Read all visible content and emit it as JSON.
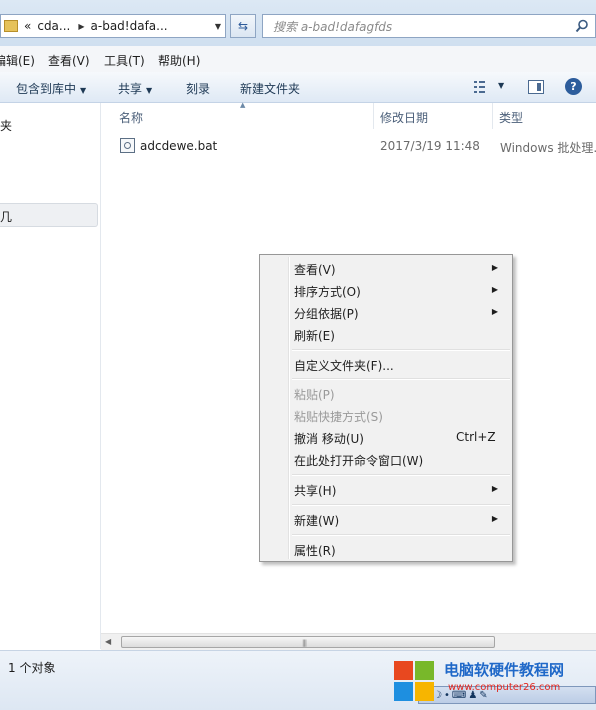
{
  "address_bar": {
    "segments": [
      "«",
      "cda...",
      "a-bad!dafa..."
    ],
    "search_placeholder": "搜索 a-bad!dafagfds"
  },
  "menubar": {
    "items": [
      "编辑(E)",
      "查看(V)",
      "工具(T)",
      "帮助(H)"
    ]
  },
  "toolbar": {
    "include_library": "包含到库中",
    "share": "共享",
    "burn": "刻录",
    "new_folder": "新建文件夹",
    "help_glyph": "?"
  },
  "navpane": {
    "item_partial_1": "夹",
    "item_partial_2": "几"
  },
  "columns": {
    "name": "名称",
    "date": "修改日期",
    "type": "类型"
  },
  "files": [
    {
      "name": "adcdewe.bat",
      "date": "2017/3/19 11:48",
      "type": "Windows 批处理..."
    }
  ],
  "context_menu": {
    "view": "查看(V)",
    "sort": "排序方式(O)",
    "group": "分组依据(P)",
    "refresh": "刷新(E)",
    "customize": "自定义文件夹(F)...",
    "paste": "粘贴(P)",
    "paste_shortcut": "粘贴快捷方式(S)",
    "undo_move": "撤消 移动(U)",
    "undo_shortcut": "Ctrl+Z",
    "open_cmd": "在此处打开命令窗口(W)",
    "share": "共享(H)",
    "new": "新建(W)",
    "properties": "属性(R)"
  },
  "statusbar": {
    "count": "1 个对象"
  },
  "watermark": {
    "title": "电脑软硬件教程网",
    "url": "www.computer26.com"
  },
  "tray": {
    "ime": "中"
  }
}
